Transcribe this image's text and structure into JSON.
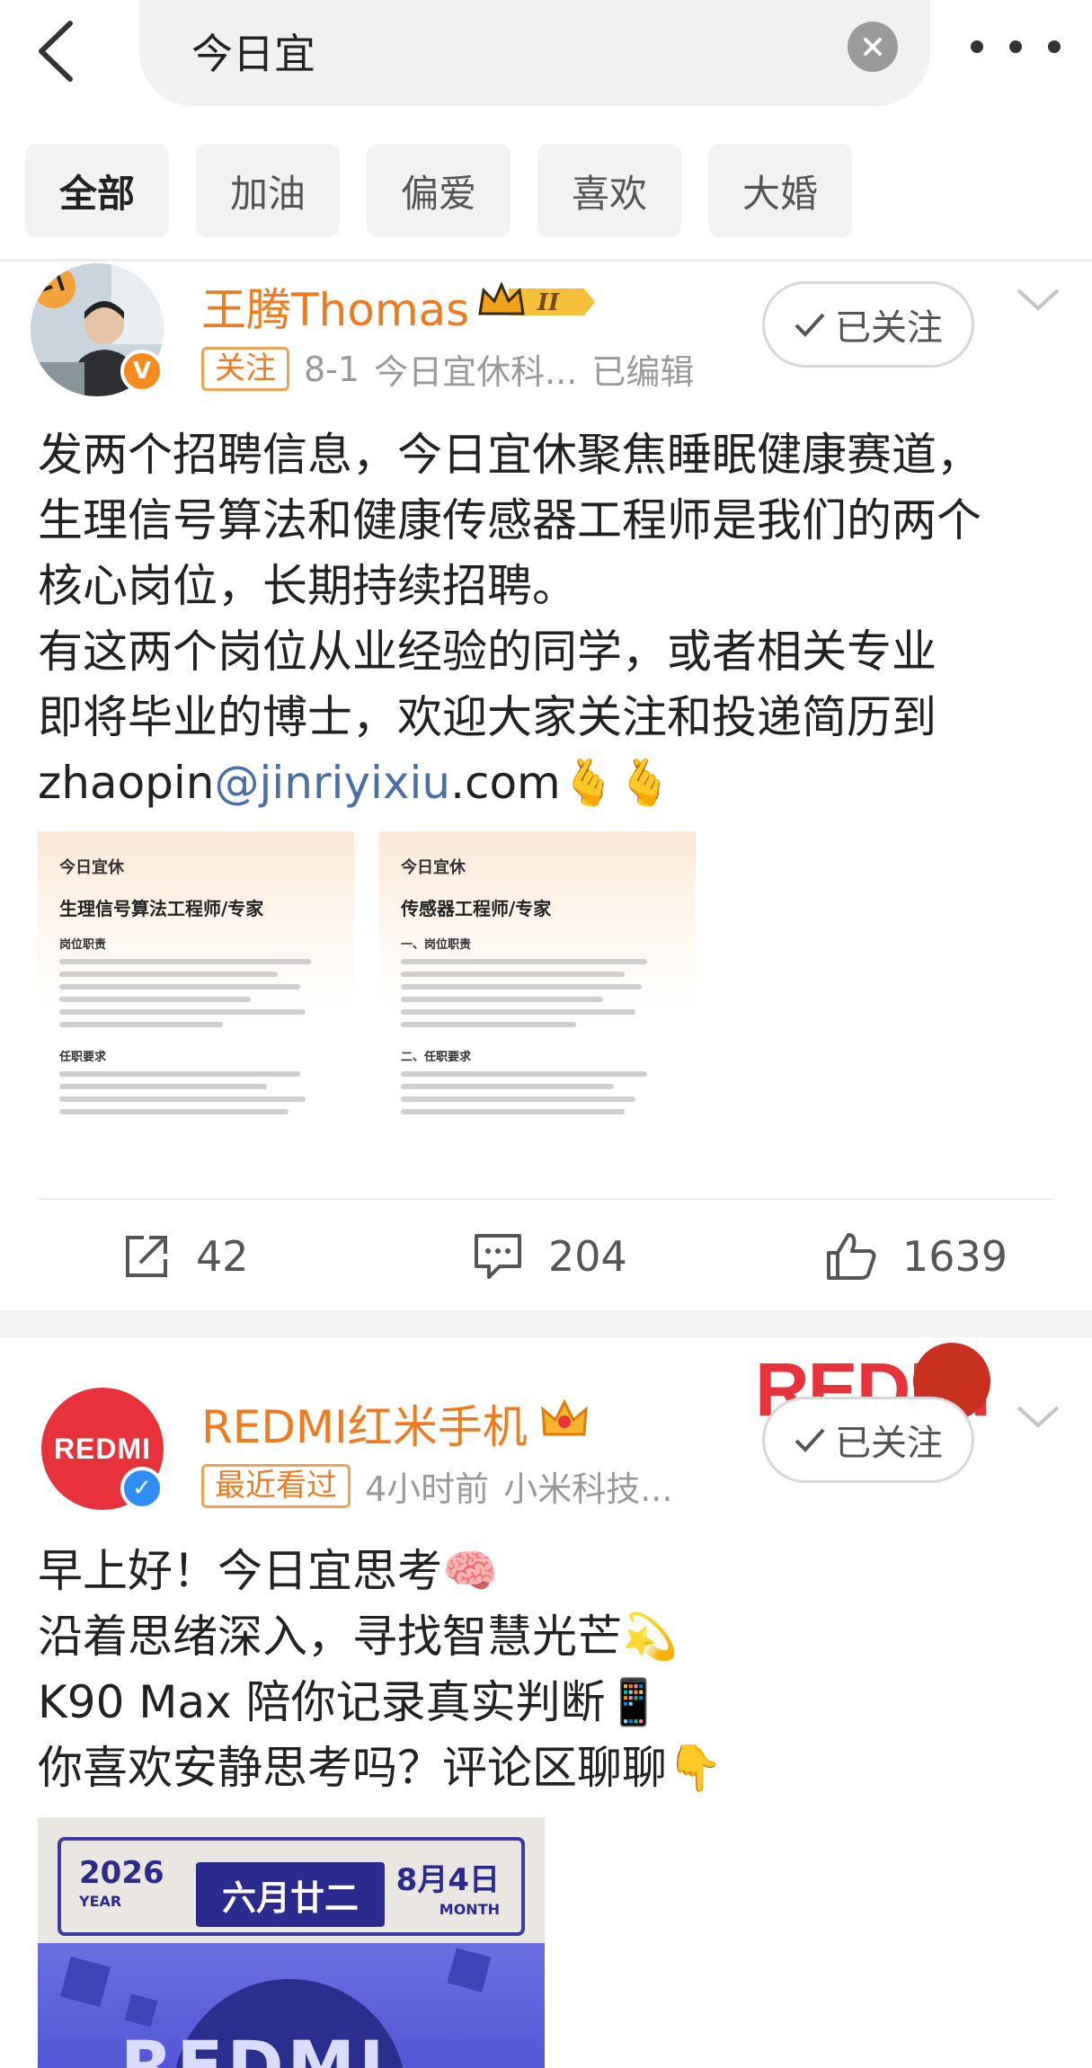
{
  "search": {
    "query": "今日宜"
  },
  "filters": [
    {
      "label": "全部",
      "active": true
    },
    {
      "label": "加油",
      "active": false
    },
    {
      "label": "偏爱",
      "active": false
    },
    {
      "label": "喜欢",
      "active": false
    },
    {
      "label": "大婚",
      "active": false
    }
  ],
  "post1": {
    "username": "王腾Thomas",
    "rank_badge": "II",
    "tag": "关注",
    "date": "8-1",
    "source": "今日宜休科...",
    "edited": "已编辑",
    "follow_label": "已关注",
    "text_lines": [
      "发两个招聘信息，今日宜休聚焦睡眠健康赛道，",
      "生理信号算法和健康传感器工程师是我们的两个",
      "核心岗位，长期持续招聘。",
      "有这两个岗位从业经验的同学，或者相关专业",
      "即将毕业的博士，欢迎大家关注和投递简历到"
    ],
    "email_prefix": "zhaopin",
    "email_link": "@jinriyixiu",
    "email_suffix": ".com",
    "email_emoji": "🫰🫰",
    "images": [
      {
        "brand": "今日宜休",
        "title": "生理信号算法工程师/专家",
        "section1": "岗位职责",
        "section2": "任职要求"
      },
      {
        "brand": "今日宜休",
        "title": "传感器工程师/专家",
        "section1": "一、岗位职责",
        "section2": "二、任职要求"
      }
    ],
    "reposts": "42",
    "comments": "204",
    "likes": "1639"
  },
  "post2": {
    "avatar_text": "REDMI",
    "username": "REDMI红米手机",
    "tag": "最近看过",
    "time": "4小时前",
    "source": "小米科技...",
    "follow_label": "已关注",
    "corner_brand": "REDMI",
    "text_lines": [
      "早上好！今日宜思考🧠",
      "沿着思绪深入，寻找智慧光芒💫",
      "K90 Max 陪你记录真实判断📱",
      "你喜欢安静思考吗？评论区聊聊👇"
    ],
    "poster": {
      "year": "2026",
      "year_label": "YEAR",
      "lunar_date": "六月廿二",
      "month_day": "8月4日",
      "month_label": "MONTH",
      "art_text": "REDMI"
    }
  },
  "colors": {
    "accent_orange": "#f07a1e",
    "link_blue": "#4a6ea6",
    "redmi_red": "#e8323a",
    "verified_blue": "#2f8ef5",
    "verified_orange": "#f58a1f"
  },
  "icons": [
    "back-arrow-icon",
    "clear-search-icon",
    "more-icon",
    "verified-icon",
    "crown-icon",
    "checkmark-icon",
    "chevron-down-icon",
    "repost-icon",
    "comment-icon",
    "like-icon"
  ]
}
